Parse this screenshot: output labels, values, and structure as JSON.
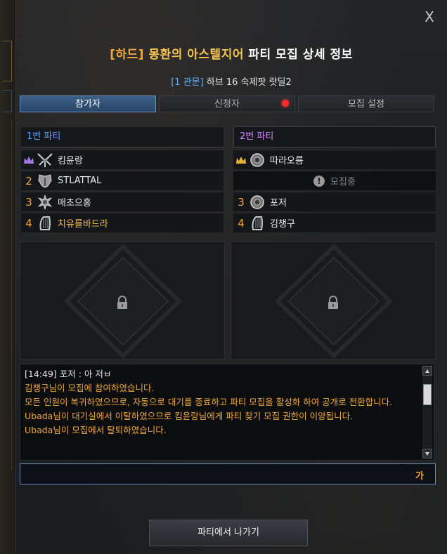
{
  "window": {
    "close_label": "X",
    "title_difficulty": "[하드]",
    "title_dungeon": "몽환의 아스텔지어",
    "title_rest": "파티 모집 상세 정보",
    "subtitle_tag": "[1 관문]",
    "subtitle_text": "하브 16 숙제팟 랏딜2"
  },
  "tabs": [
    {
      "label": "참가자",
      "active": true
    },
    {
      "label": "신청자",
      "active": false,
      "notification": true
    },
    {
      "label": "모집 설정",
      "active": false
    }
  ],
  "parties": [
    {
      "header": "1번 파티",
      "members": [
        {
          "slot": "",
          "leader": true,
          "name": "킴윤랑",
          "class_icon": "blade-class-icon"
        },
        {
          "slot": "2",
          "name": "STLATTAL",
          "class_icon": "wings-class-icon"
        },
        {
          "slot": "3",
          "name": "매초으홍",
          "class_icon": "spiked-class-icon"
        },
        {
          "slot": "4",
          "name": "치유를바드라",
          "class_icon": "harp-class-icon",
          "highlight": true
        }
      ]
    },
    {
      "header": "2번 파티",
      "members": [
        {
          "slot": "",
          "leader": true,
          "name": "따라오름",
          "class_icon": "shield-class-icon"
        },
        {
          "slot": "",
          "recruiting": true,
          "name": "모집중"
        },
        {
          "slot": "3",
          "name": "포저",
          "class_icon": "shield-class-icon"
        },
        {
          "slot": "4",
          "name": "김챙구",
          "class_icon": "harp-class-icon"
        }
      ]
    }
  ],
  "chat": {
    "lines": [
      {
        "text": "[14:49] 포저 : 아 저ㅂ",
        "color": "white"
      },
      {
        "text": "김챙구님이 모집에 참여하였습니다.",
        "color": "orange"
      },
      {
        "text": "모든 인원이 복귀하였으므로, 자동으로 대기를 종료하고 파티 모집을 활성화 하여 공개로 전환합니다.",
        "color": "orange"
      },
      {
        "text": "Ubada님이 대기실에서 이탈하였으므로 킴윤랑님에게 파티 찾기 모집 권한이 이양됩니다.",
        "color": "orange"
      },
      {
        "text": "Ubada님이 모집에서 탈퇴하였습니다.",
        "color": "orange"
      }
    ],
    "input_value": "",
    "ime_indicator": "가"
  },
  "footer": {
    "leave_label": "파티에서 나가기"
  },
  "colors": {
    "accent_blue": "#5ea4ff",
    "accent_purple": "#d38bff",
    "accent_gold": "#f0a83c",
    "tab_active": "#3c5f86",
    "notification_red": "#ff2a2a"
  }
}
